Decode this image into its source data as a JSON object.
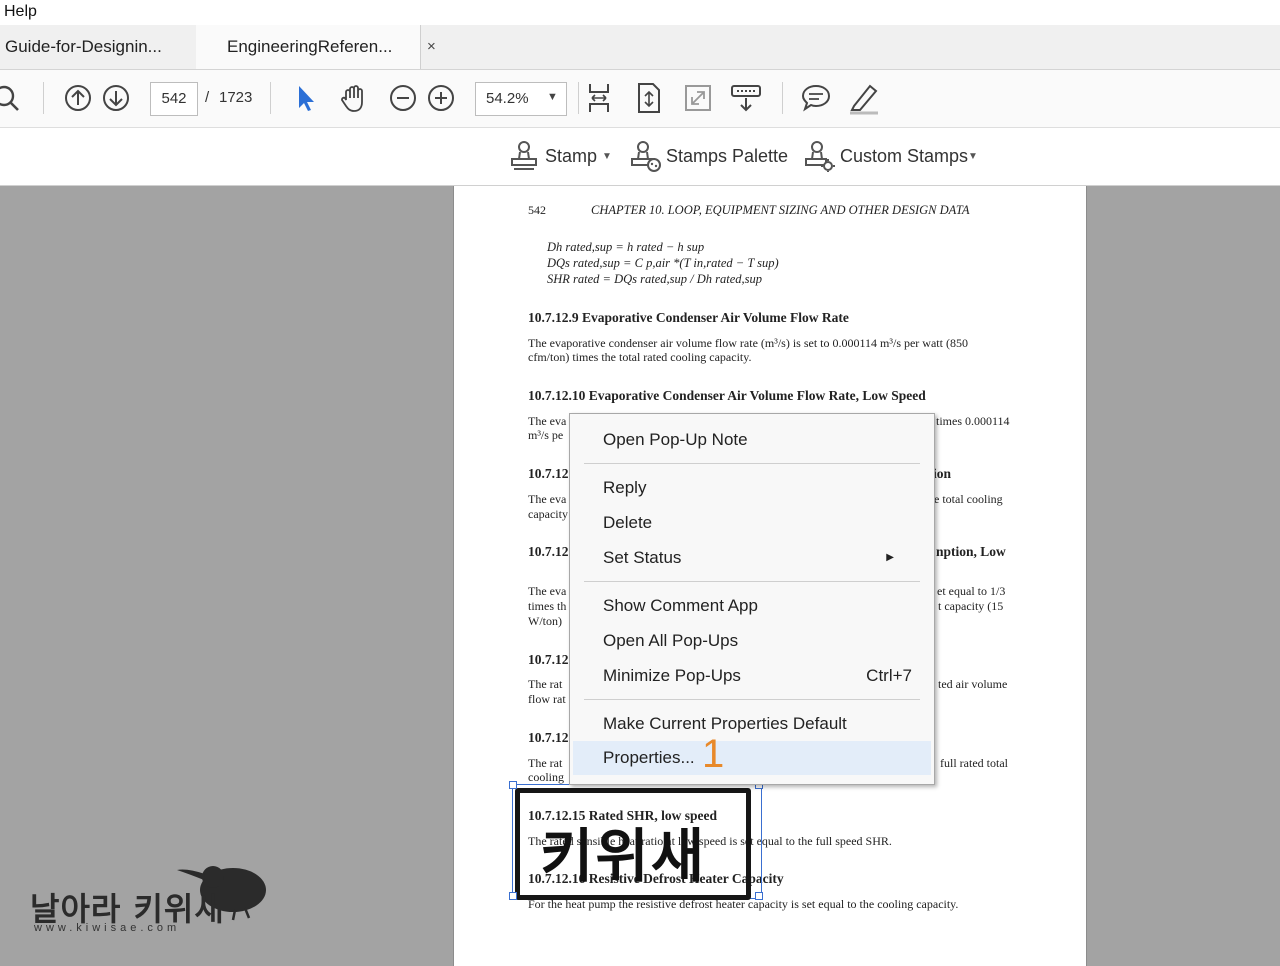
{
  "menubar": {
    "help": "Help"
  },
  "tabs": [
    {
      "label": "Guide-for-Designin..."
    },
    {
      "label": "EngineeringReferen...",
      "close": "×"
    }
  ],
  "toolbar": {
    "page_current": "542",
    "page_separator": "/",
    "page_total": "1723",
    "zoom": "54.2%",
    "icons": [
      "search-icon",
      "page-up-icon",
      "page-down-icon",
      "select-cursor-icon",
      "hand-icon",
      "zoom-out-icon",
      "zoom-in-icon",
      "fit-page-icon",
      "scroll-mode-icon",
      "full-screen-icon",
      "read-mode-icon",
      "comment-icon",
      "highlight-icon"
    ]
  },
  "stampbar": {
    "stamp_label": "Stamp",
    "palette_label": "Stamps Palette",
    "custom_label": "Custom Stamps"
  },
  "document": {
    "page_number": "542",
    "chapter": "CHAPTER 10.  LOOP, EQUIPMENT SIZING AND OTHER DESIGN DATA",
    "eq1": "Dh rated,sup = h rated − h sup",
    "eq2": "DQs rated,sup = C p,air *(T in,rated − T sup)",
    "eq3": "SHR rated = DQs rated,sup / Dh rated,sup",
    "h1": "10.7.12.9   Evaporative Condenser Air Volume Flow Rate",
    "p1a": "The evaporative condenser air volume flow rate (m³/s) is set to 0.000114 m³/s per watt (850",
    "p1b": "cfm/ton) times the total rated cooling capacity.",
    "h2": "10.7.12.10   Evaporative Condenser Air Volume Flow Rate, Low Speed",
    "p2a_left": "The eva",
    "p2a_right": "times 0.000114",
    "p2b_left": "m³/s pe",
    "h3_left": "10.7.12",
    "h3_right": "ion",
    "p3a_left": "The eva",
    "p3a_right": "e total cooling",
    "p3b_left": "capacity",
    "h4_left": "10.7.12",
    "h4_right": "nption,  Low",
    "p4a_left": "The eva",
    "p4a_right": "et equal to 1/3",
    "p4b_left": "times th",
    "p4b_right": "t capacity (15",
    "p4c_left": "W/ton)",
    "h5_left": "10.7.12",
    "p5a_left": "The rat",
    "p5a_right": "ted air volume",
    "p5b_left": "flow rat",
    "h6_left": "10.7.12",
    "p6a_left": "The rat",
    "p6a_right": "full rated total",
    "p6b_left": "cooling",
    "h7": "10.7.12.15   Rated SHR, low speed",
    "p7": "The rated sensible heat ratio at low speed is set equal to the full speed SHR.",
    "h8": "10.7.12.16   Resistive Defrost Heater Capacity",
    "p8": "For the heat pump the resistive defrost heater capacity is set equal to the cooling capacity."
  },
  "context_menu": {
    "items": [
      {
        "label": "Open Pop-Up Note"
      },
      {
        "label": "Reply"
      },
      {
        "label": "Delete"
      },
      {
        "label": "Set Status",
        "submenu": "▶"
      },
      {
        "label": "Show Comment App"
      },
      {
        "label": "Open All Pop-Ups"
      },
      {
        "label": "Minimize Pop-Ups",
        "shortcut": "Ctrl+7"
      },
      {
        "label": "Make Current Properties Default"
      },
      {
        "label": "Properties..."
      }
    ]
  },
  "annotation_badge": "1",
  "stamp": {
    "text": "키위새"
  },
  "watermark": {
    "title": "날아라 키위새",
    "url": "www.kiwisae.com"
  },
  "colors": {
    "accent": "#2b6fd6",
    "badge": "#e8892a",
    "menu_highlight": "#e3edf9"
  }
}
